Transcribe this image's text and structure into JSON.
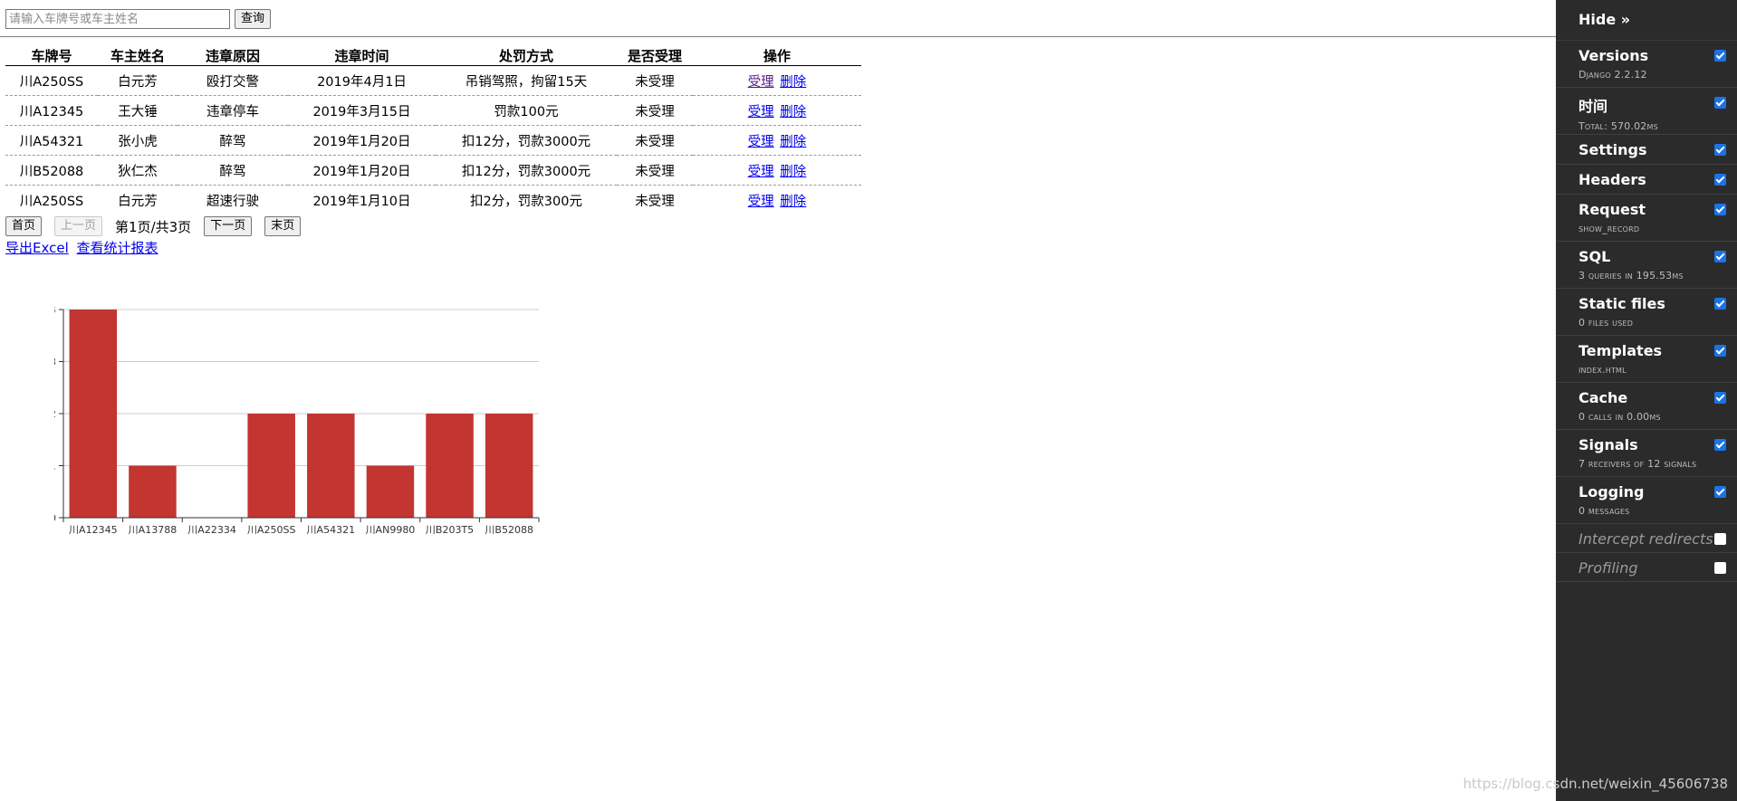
{
  "search": {
    "placeholder": "请输入车牌号或车主姓名",
    "button_label": "查询"
  },
  "table": {
    "headers": [
      "车牌号",
      "车主姓名",
      "违章原因",
      "违章时间",
      "处罚方式",
      "是否受理",
      "操作"
    ],
    "rows": [
      {
        "plate": "川A250SS",
        "owner": "白元芳",
        "reason": "殴打交警",
        "time": "2019年4月1日",
        "penalty": "吊销驾照，拘留15天",
        "status": "未受理",
        "accept": "受理",
        "delete": "删除"
      },
      {
        "plate": "川A12345",
        "owner": "王大锤",
        "reason": "违章停车",
        "time": "2019年3月15日",
        "penalty": "罚款100元",
        "status": "未受理",
        "accept": "受理",
        "delete": "删除"
      },
      {
        "plate": "川A54321",
        "owner": "张小虎",
        "reason": "醉驾",
        "time": "2019年1月20日",
        "penalty": "扣12分，罚款3000元",
        "status": "未受理",
        "accept": "受理",
        "delete": "删除"
      },
      {
        "plate": "川B52088",
        "owner": "狄仁杰",
        "reason": "醉驾",
        "time": "2019年1月20日",
        "penalty": "扣12分，罚款3000元",
        "status": "未受理",
        "accept": "受理",
        "delete": "删除"
      },
      {
        "plate": "川A250SS",
        "owner": "白元芳",
        "reason": "超速行驶",
        "time": "2019年1月10日",
        "penalty": "扣2分，罚款300元",
        "status": "未受理",
        "accept": "受理",
        "delete": "删除"
      }
    ]
  },
  "pagination": {
    "first": "首页",
    "prev": "上一页",
    "info": "第1页/共3页",
    "next": "下一页",
    "last": "末页"
  },
  "links": {
    "export": "导出Excel",
    "stats": "查看统计报表"
  },
  "chart_data": {
    "type": "bar",
    "categories": [
      "川A12345",
      "川A13788",
      "川A22334",
      "川A250SS",
      "川A54321",
      "川AN9980",
      "川B203T5",
      "川B52088"
    ],
    "values": [
      4,
      1,
      0,
      2,
      2,
      1,
      2,
      2
    ],
    "ylim": [
      0,
      4
    ],
    "yticks": [
      "0",
      "1",
      "2",
      "3",
      "4"
    ],
    "grid": true,
    "bar_color": "#c23531"
  },
  "toolbar": {
    "hide_label": "Hide »",
    "panels": [
      {
        "title": "Versions",
        "subtitle": "Django 2.2.12",
        "checked": true
      },
      {
        "title": "时间",
        "subtitle": "Total: 570.02ms",
        "checked": true
      },
      {
        "title": "Settings",
        "subtitle": "",
        "checked": true
      },
      {
        "title": "Headers",
        "subtitle": "",
        "checked": true
      },
      {
        "title": "Request",
        "subtitle": "show_record",
        "checked": true
      },
      {
        "title": "SQL",
        "subtitle": "3 queries in 195.53ms",
        "checked": true
      },
      {
        "title": "Static files",
        "subtitle": "0 files used",
        "checked": true
      },
      {
        "title": "Templates",
        "subtitle": "index.html",
        "checked": true
      },
      {
        "title": "Cache",
        "subtitle": "0 calls in 0.00ms",
        "checked": true
      },
      {
        "title": "Signals",
        "subtitle": "7 receivers of 12 signals",
        "checked": true
      },
      {
        "title": "Logging",
        "subtitle": "0 messages",
        "checked": true
      },
      {
        "title": "Intercept redirects",
        "subtitle": "",
        "checked": false
      },
      {
        "title": "Profiling",
        "subtitle": "",
        "checked": false
      }
    ]
  },
  "watermark": "https://blog.csdn.net/weixin_45606738"
}
